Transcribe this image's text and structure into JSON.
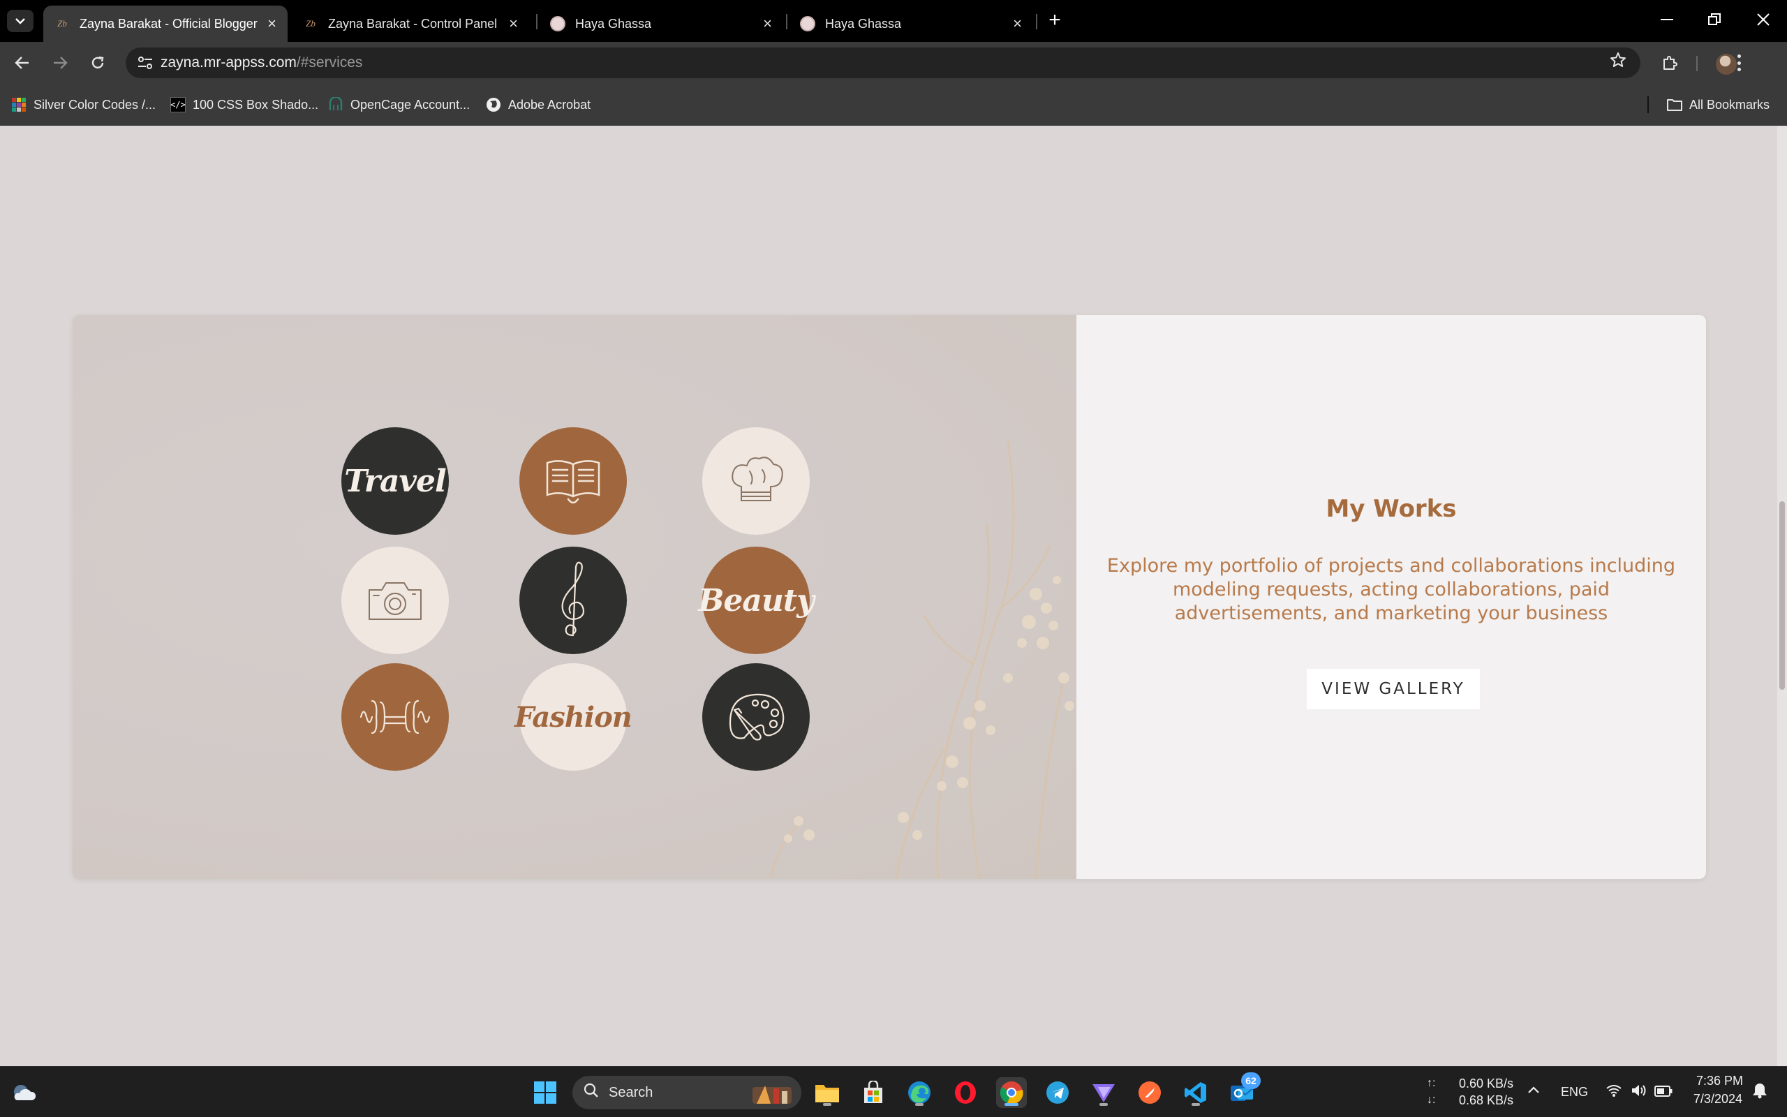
{
  "browser": {
    "tabs": [
      {
        "title": "Zayna Barakat - Official Blogger",
        "favicon": "Zb",
        "active": true
      },
      {
        "title": "Zayna Barakat - Control Panel",
        "favicon": "Zb",
        "active": false
      },
      {
        "title": "Haya Ghassa",
        "favicon": "round",
        "active": false
      },
      {
        "title": "Haya Ghassa",
        "favicon": "round",
        "active": false
      }
    ],
    "url_host": "zayna.mr-appss.com",
    "url_path": "/#services",
    "bookmarks": [
      {
        "label": "Silver Color Codes /...",
        "icon": "palette-grid-icon"
      },
      {
        "label": "100 CSS Box Shado...",
        "icon": "code-icon"
      },
      {
        "label": "OpenCage Account...",
        "icon": "opencage-icon"
      },
      {
        "label": "Adobe Acrobat",
        "icon": "globe-icon"
      }
    ],
    "all_bookmarks": "All Bookmarks"
  },
  "works": {
    "title": "My Works",
    "description": "Explore my portfolio of projects and collaborations including modeling requests, acting collaborations, paid advertisements, and marketing your business",
    "button": "VIEW GALLERY",
    "bubbles": [
      {
        "name": "travel",
        "style": "dark",
        "word": "Travel"
      },
      {
        "name": "books",
        "style": "brown",
        "icon": "open-book-icon"
      },
      {
        "name": "cooking",
        "style": "cream",
        "icon": "chef-hat-icon"
      },
      {
        "name": "photography",
        "style": "cream",
        "icon": "camera-icon"
      },
      {
        "name": "music",
        "style": "dark",
        "icon": "treble-clef-icon"
      },
      {
        "name": "beauty",
        "style": "brown",
        "word": "Beauty"
      },
      {
        "name": "fitness",
        "style": "brown",
        "icon": "dumbbell-icon"
      },
      {
        "name": "fashion",
        "style": "cream",
        "word": "Fashion"
      },
      {
        "name": "art",
        "style": "dark",
        "icon": "paint-palette-icon"
      }
    ]
  },
  "taskbar": {
    "search_label": "Search",
    "mail_badge": "62",
    "upload_speed": "0.60 KB/s",
    "download_speed": "0.68 KB/s",
    "upload_arrow": "↑:",
    "download_arrow": "↓:",
    "language": "ENG",
    "time": "7:36 PM",
    "date": "7/3/2024"
  },
  "colors": {
    "page_bg": "#dcd7d6",
    "accent_brown": "#a0673f",
    "title_brown": "#a66b3c",
    "dark_bubble": "#2f302e",
    "cream_bubble": "#f0e8e0"
  }
}
